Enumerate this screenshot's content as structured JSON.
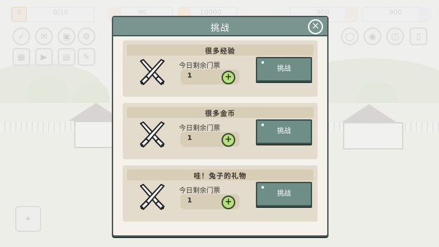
{
  "top_stats": [
    {
      "value": "0"
    },
    {
      "value": "0/10"
    },
    {
      "value": "90"
    },
    {
      "value": "10000"
    },
    {
      "value": "900"
    },
    {
      "value": "900"
    }
  ],
  "dialog": {
    "title": "挑战",
    "close_icon": "close-icon",
    "cards": [
      {
        "title": "很多经验",
        "ticket_label": "今日剩余门票",
        "count": "1",
        "button_label": "挑战"
      },
      {
        "title": "很多金币",
        "ticket_label": "今日剩余门票",
        "count": "1",
        "button_label": "挑战"
      },
      {
        "title": "哇！兔子的礼物",
        "ticket_label": "今日剩余门票",
        "count": "1",
        "button_label": "挑战"
      }
    ]
  },
  "icons": {
    "swords": "crossed-swords-icon",
    "plus": "plus-icon"
  },
  "colors": {
    "header": "#7a9590",
    "button": "#6f8e88",
    "plus": "#b8e17e"
  }
}
